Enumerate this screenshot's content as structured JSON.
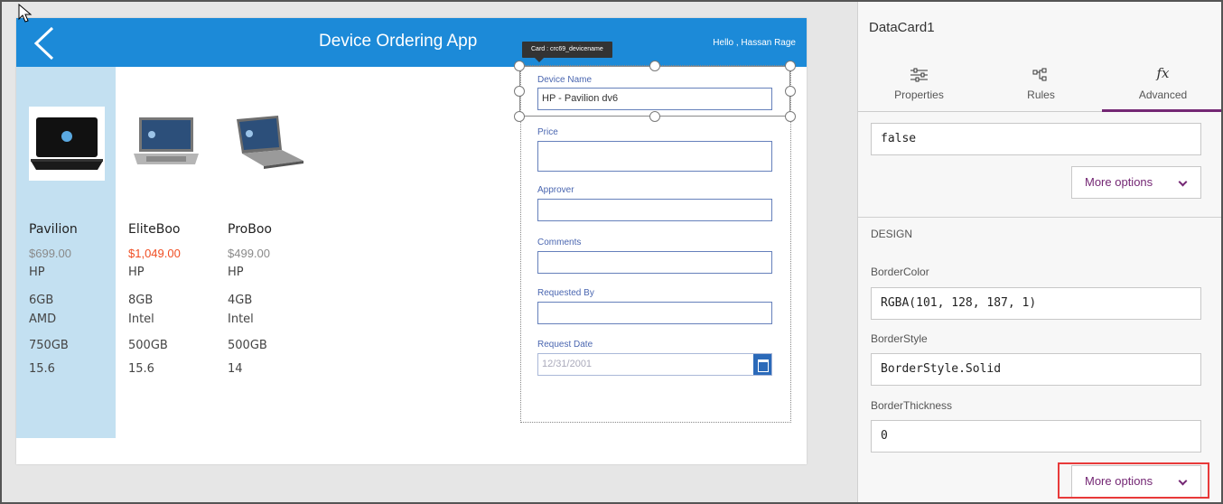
{
  "app": {
    "title": "Device Ordering App",
    "greeting": "Hello , Hassan Rage"
  },
  "tooltip": "Card : crc69_devicename",
  "products": [
    {
      "name": "Pavilion",
      "price": "$699.00",
      "make": "HP",
      "ram": "6GB",
      "cpu": "AMD",
      "hdd": "750GB",
      "screen": "15.6"
    },
    {
      "name": "EliteBoo",
      "price": "$1,049.00",
      "make": "HP",
      "ram": "8GB",
      "cpu": "Intel",
      "hdd": "500GB",
      "screen": "15.6"
    },
    {
      "name": "ProBoo",
      "price": "$499.00",
      "make": "HP",
      "ram": "4GB",
      "cpu": "Intel",
      "hdd": "500GB",
      "screen": "14"
    }
  ],
  "form": {
    "device_name_label": "Device Name",
    "device_name_value": "HP - Pavilion dv6",
    "price_label": "Price",
    "approver_label": "Approver",
    "comments_label": "Comments",
    "requested_by_label": "Requested By",
    "request_date_label": "Request Date",
    "request_date_value": "12/31/2001"
  },
  "panel": {
    "card_name": "DataCard1",
    "tabs": [
      {
        "label": "Properties",
        "icon": "sliders-icon"
      },
      {
        "label": "Rules",
        "icon": "rules-icon"
      },
      {
        "label": "Advanced",
        "icon": "fx-icon"
      }
    ],
    "fx_glyph": "fx",
    "advanced_value": "false",
    "more_options": "More options",
    "design_title": "DESIGN",
    "border_color_label": "BorderColor",
    "border_color_value": "RGBA(101, 128, 187, 1)",
    "border_style_label": "BorderStyle",
    "border_style_value": "BorderStyle.Solid",
    "border_thickness_label": "BorderThickness",
    "border_thickness_value": "0"
  },
  "colors": {
    "appbar": "#1c8ad8",
    "selected_item": "#c3e0f1",
    "accent": "#742774",
    "price_highlight": "#f04e23",
    "callout": "#e83a3a"
  }
}
